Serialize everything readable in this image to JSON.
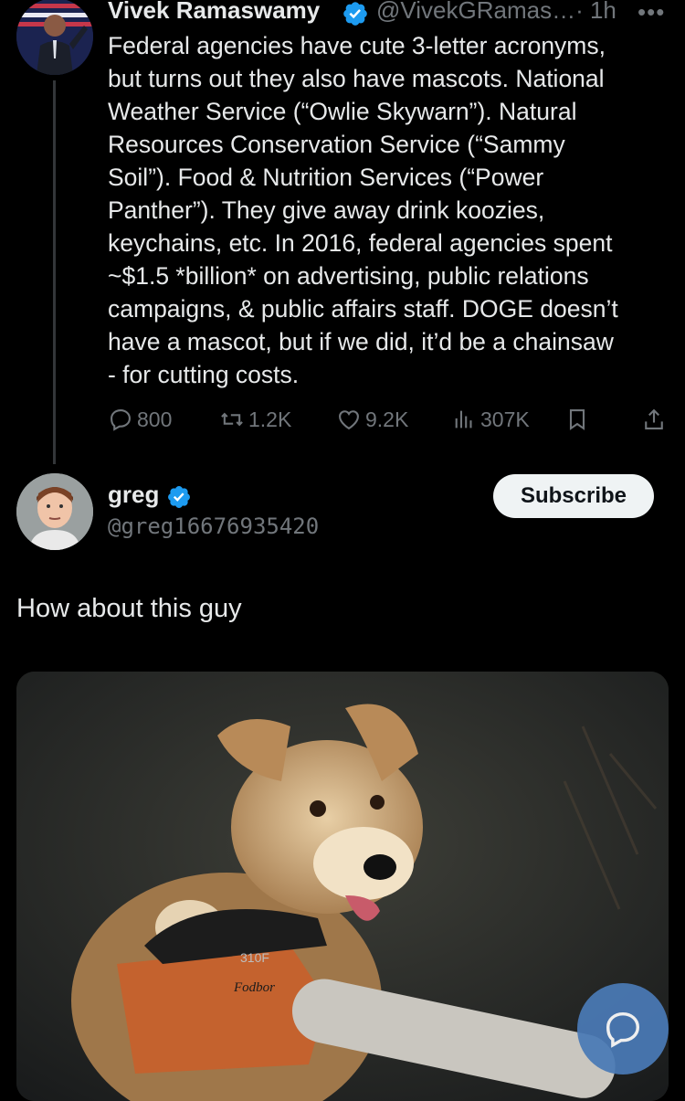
{
  "original_tweet": {
    "author_name": "Vivek Ramaswamy",
    "handle": "@VivekGRamas…",
    "time": "· 1h",
    "more": "•••",
    "text": "Federal agencies have cute 3-letter acronyms,\nbut turns out they also have mascots. National\nWeather Service (“Owlie Skywarn”). Natural\nResources Conservation Service (“Sammy\nSoil”). Food & Nutrition Services (“Power\nPanther”). They give away drink koozies,\nkeychains, etc. In 2016, federal agencies spent\n~$1.5 *billion* on advertising, public relations\ncampaigns, & public affairs staff. DOGE doesn’t\nhave a mascot, but if we did, it’d be a chainsaw\n- for cutting costs.",
    "replies": "800",
    "reposts": "1.2K",
    "likes": "9.2K",
    "views": "307K"
  },
  "reply_tweet": {
    "author_name": "greg",
    "handle": "@greg16676935420",
    "subscribe_label": "Subscribe",
    "text": "How about this guy",
    "media_text": {
      "chainsaw_brand": "Fodbor",
      "chainsaw_model": "310F"
    }
  },
  "colors": {
    "accent": "#1d9bf0",
    "secondary_text": "#71767b",
    "fab": "#4a7ab6"
  },
  "icons": [
    "verified-icon",
    "reply-icon",
    "repost-icon",
    "like-icon",
    "views-icon",
    "bookmark-icon",
    "share-icon",
    "compose-icon"
  ]
}
